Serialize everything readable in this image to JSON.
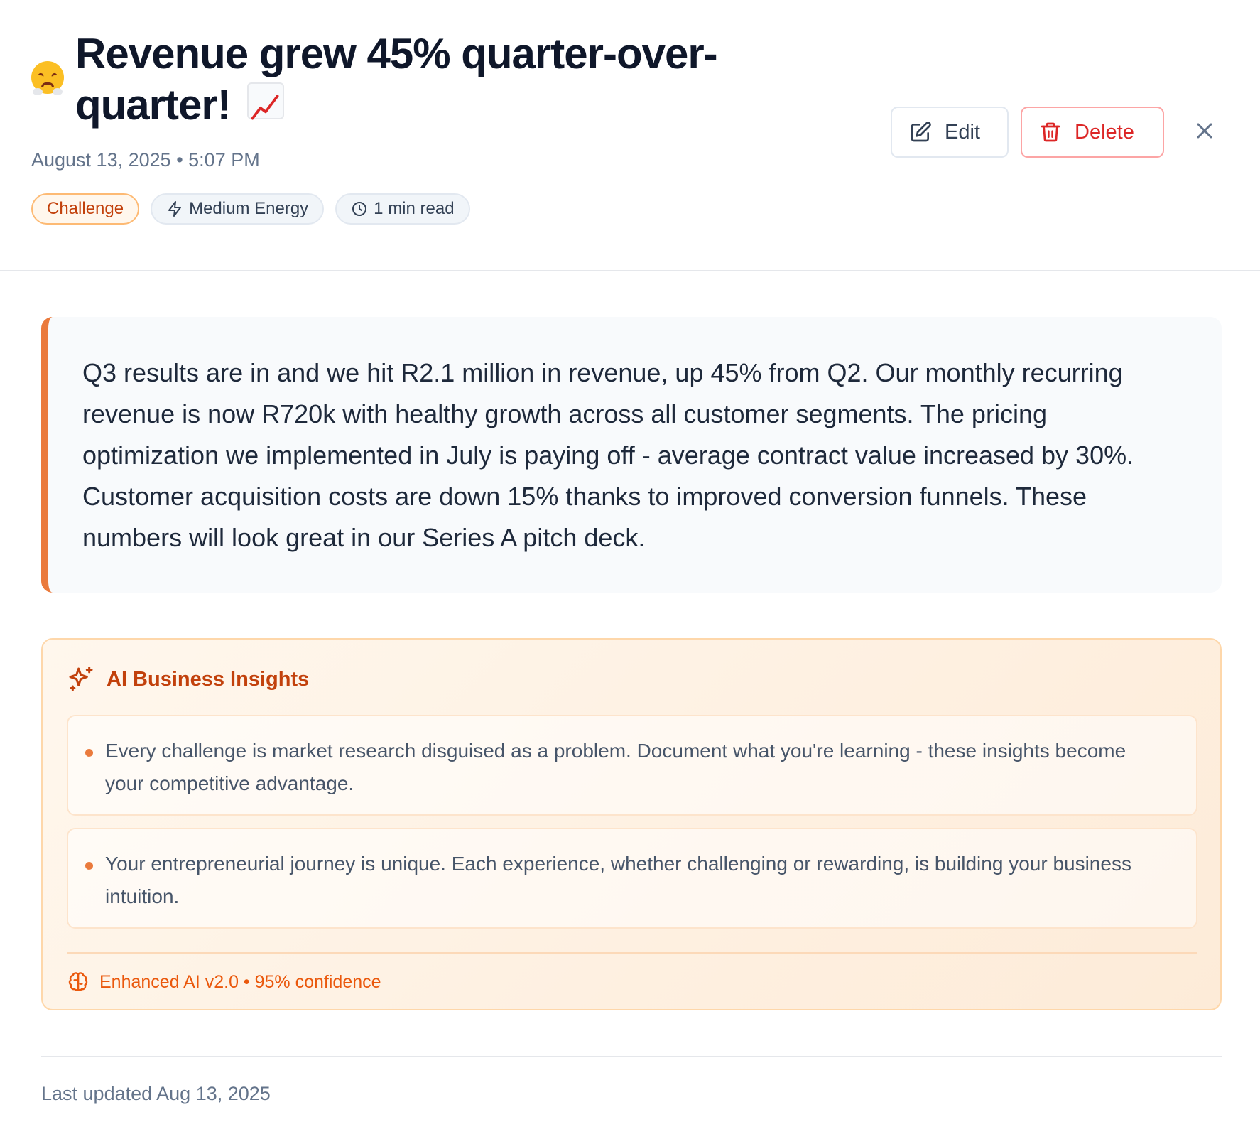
{
  "header": {
    "mood_emoji": "steam-from-nose-emoji",
    "title": "Revenue grew 45% quarter-over-quarter!",
    "title_emoji": "chart-increasing-emoji",
    "date": "August 13, 2025",
    "separator": "•",
    "time": "5:07 PM",
    "chips": [
      {
        "label": "Challenge",
        "icon": ""
      },
      {
        "label": "Medium Energy",
        "icon": "lightning-icon"
      },
      {
        "label": "1 min read",
        "icon": "clock-icon"
      }
    ],
    "actions": {
      "edit_label": "Edit",
      "delete_label": "Delete"
    }
  },
  "entry": {
    "body": "Q3 results are in and we hit R2.1 million in revenue, up 45% from Q2. Our monthly recurring revenue is now R720k with healthy growth across all customer segments. The pricing optimization we implemented in July is paying off - average contract value increased by 30%. Customer acquisition costs are down 15% thanks to improved conversion funnels. These numbers will look great in our Series A pitch deck."
  },
  "insights": {
    "title": "AI Business Insights",
    "items": [
      "Every challenge is market research disguised as a problem. Document what you're learning - these insights become your competitive advantage.",
      "Your entrepreneurial journey is unique. Each experience, whether challenging or rewarding, is building your business intuition."
    ],
    "footer": "Enhanced AI v2.0 • 95% confidence"
  },
  "footer": {
    "last_updated": "Last updated Aug 13, 2025"
  },
  "colors": {
    "accent": "#ea7a3c",
    "challenge": "#c2410c",
    "delete": "#dc2626"
  }
}
